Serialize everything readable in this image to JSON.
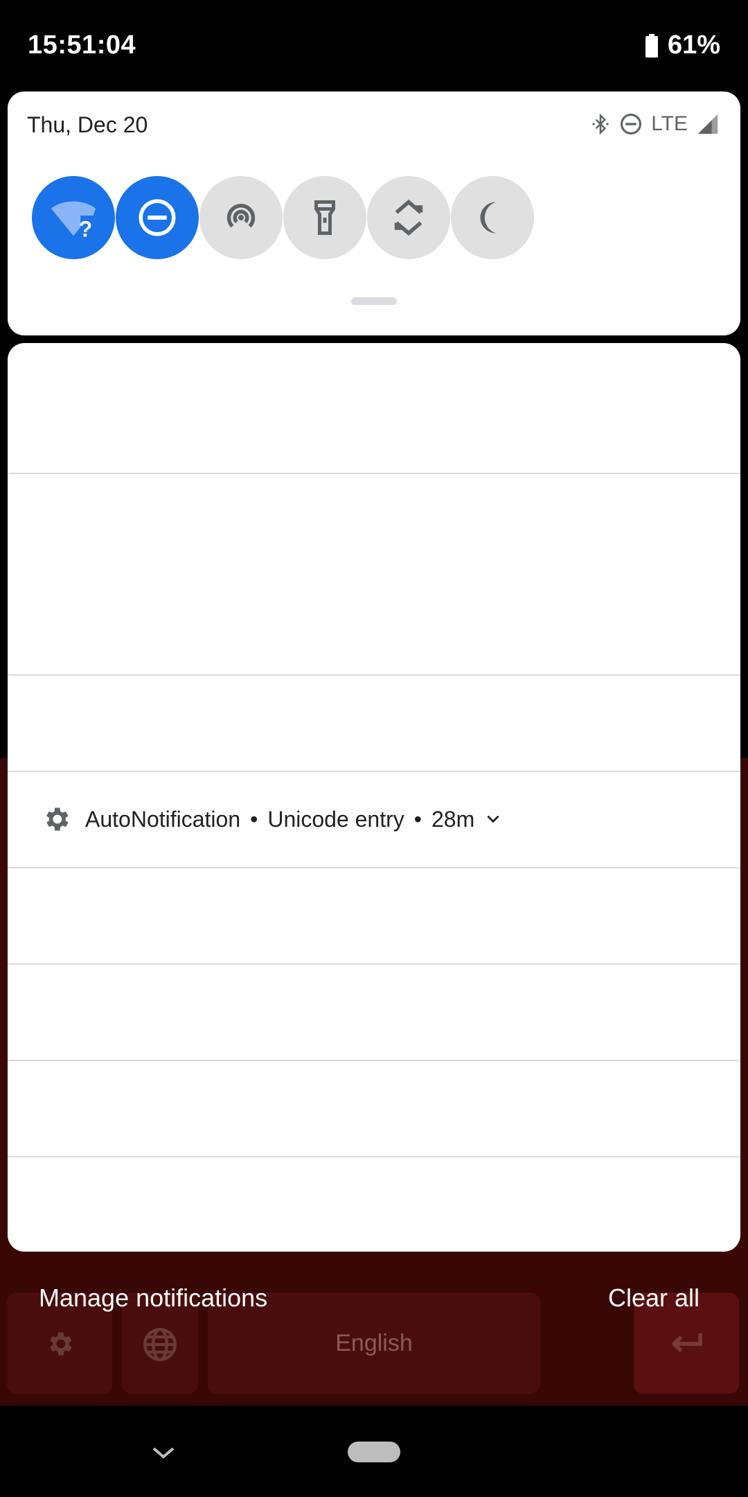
{
  "status_bar": {
    "time": "15:51:04",
    "battery_percent": "61%",
    "battery_level": 0.61
  },
  "quick_settings": {
    "date": "Thu, Dec 20",
    "network_label": "LTE",
    "tiles": [
      {
        "name": "wifi",
        "icon": "wifi-question-icon",
        "state": "on"
      },
      {
        "name": "do-not-disturb",
        "icon": "dnd-icon",
        "state": "on"
      },
      {
        "name": "hotspot",
        "icon": "hotspot-icon",
        "state": "off"
      },
      {
        "name": "flashlight",
        "icon": "flashlight-icon",
        "state": "off"
      },
      {
        "name": "auto-rotate",
        "icon": "rotate-icon",
        "state": "off"
      },
      {
        "name": "night-light",
        "icon": "moon-icon",
        "state": "off"
      }
    ],
    "colors": {
      "active": "#1a73e8",
      "inactive": "#e0e0e0"
    }
  },
  "notification": {
    "app": "AutoNotification",
    "channel": "Unicode entry",
    "time": "28m",
    "separator": "•",
    "icon": "gear-icon"
  },
  "footer": {
    "manage": "Manage notifications",
    "clear_all": "Clear all"
  },
  "keyboard": {
    "space_label": "English"
  }
}
